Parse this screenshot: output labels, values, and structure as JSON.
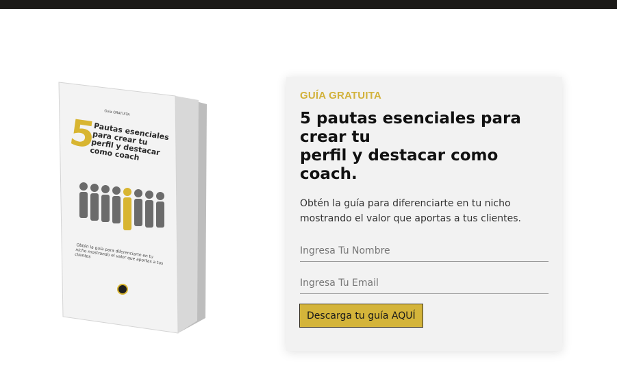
{
  "book": {
    "small_label": "Guía GRATUITA",
    "number": "5",
    "title": "Pautas esenciales para crear tu perfil y destacar como coach",
    "subtitle": "Obtén la guía para diferenciarte en tu nicho mostrando el valor que aportas a tus clientes",
    "accent_color": "#d8b531"
  },
  "card": {
    "eyebrow": "GUÍA GRATUITA",
    "headline_lines": [
      "5 pautas esenciales para",
      "crear tu",
      "perfil y destacar como",
      "coach."
    ],
    "description": "Obtén la guía para diferenciarte en tu nicho mostrando el valor que aportas a tus clientes.",
    "name_placeholder": "Ingresa Tu Nombre",
    "email_placeholder": "Ingresa Tu Email",
    "cta_label": "Descarga tu guía AQUÍ",
    "accent_color": "#d4b43a"
  }
}
